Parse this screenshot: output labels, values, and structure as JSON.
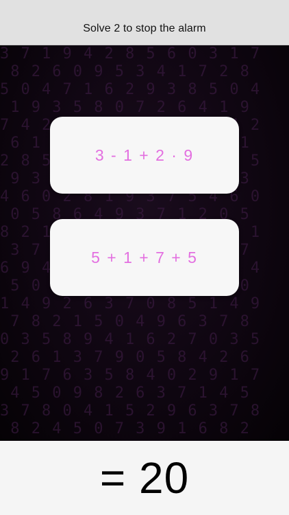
{
  "header": {
    "title": "Solve 2 to stop the alarm"
  },
  "problems": [
    {
      "expression": "3 - 1 + 2 · 9"
    },
    {
      "expression": "5 + 1 + 7 + 5"
    }
  ],
  "answer": {
    "display": "= 20"
  },
  "colors": {
    "header_bg": "#e1e1e1",
    "stage_bg": "#0f0611",
    "card_bg": "#f7f7f7",
    "expression_text": "#e36fe0",
    "answer_bar_bg": "#f5f5f5"
  }
}
